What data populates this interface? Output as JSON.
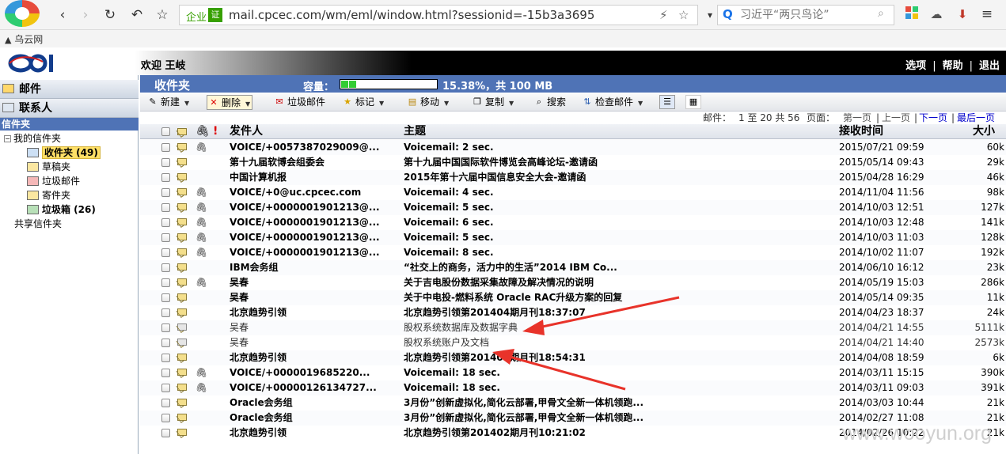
{
  "browser": {
    "url_badge": "企业",
    "cert_badge": "证",
    "url": "mail.cpcec.com/wm/eml/window.html?sessionid=-15b3a3695",
    "search_placeholder": "习近平“两只鸟论”",
    "bookmark": "乌云网"
  },
  "header": {
    "welcome": "欢迎 王岐",
    "links": [
      "选项",
      "帮助",
      "退出"
    ]
  },
  "sidebar": {
    "tabs": [
      "邮件",
      "联系人"
    ],
    "folder_header": "信件夹",
    "my_folders": "我的信件夹",
    "folders": [
      {
        "label": "收件夹 (49)",
        "icon": "inbox-icon",
        "selected": true
      },
      {
        "label": "草稿夹",
        "icon": "draft-folder-icon"
      },
      {
        "label": "垃圾邮件",
        "icon": "spam-folder-icon"
      },
      {
        "label": "寄件夹",
        "icon": "sent-folder-icon"
      },
      {
        "label": "垃圾箱 (26)",
        "icon": "trash-folder-icon",
        "bold": true
      }
    ],
    "shared": "共享信件夹"
  },
  "main": {
    "folder_title": "收件夹",
    "capacity_label": "容量：",
    "capacity_percent": 15.38,
    "capacity_text": "15.38%，共 100 MB",
    "toolbar": {
      "new": "新建",
      "delete": "删除",
      "spam": "垃圾邮件",
      "mark": "标记",
      "move": "移动",
      "copy": "复制",
      "search": "搜索",
      "check": "检查邮件"
    },
    "pager": {
      "mail_label": "邮件：",
      "range": "1 至 20 共 56",
      "page_label": "页面：",
      "first": "第一页",
      "sep": "|",
      "prev": "上一页",
      "next": "下一页",
      "last": "最后一页"
    },
    "columns": {
      "sender": "发件人",
      "subject": "主题",
      "date": "接收时间",
      "size": "大小"
    },
    "messages": [
      {
        "sender": "VOICE/+0057387029009@...",
        "subject": "Voicemail: 2 sec.",
        "date": "2015/07/21 09:59",
        "size": "60k"
      },
      {
        "sender": "第十九届软博会组委会",
        "subject": "第十九届中国国际软件博览会高峰论坛-邀请函",
        "date": "2015/05/14 09:43",
        "size": "29k"
      },
      {
        "sender": "中国计算机报",
        "subject": "2015年第十六届中国信息安全大会-邀请函",
        "date": "2015/04/28 16:29",
        "size": "46k"
      },
      {
        "sender": "VOICE/+0@uc.cpcec.com",
        "subject": "Voicemail: 4 sec.",
        "date": "2014/11/04 11:56",
        "size": "98k"
      },
      {
        "sender": "VOICE/+000000190121З@...",
        "subject": "Voicemail: 5 sec.",
        "date": "2014/10/03 12:51",
        "size": "127k"
      },
      {
        "sender": "VOICE/+000000190121З@...",
        "subject": "Voicemail: 6 sec.",
        "date": "2014/10/03 12:48",
        "size": "141k"
      },
      {
        "sender": "VOICE/+000000190121З@...",
        "subject": "Voicemail: 5 sec.",
        "date": "2014/10/03 11:03",
        "size": "128k"
      },
      {
        "sender": "VOICE/+000000190121З@...",
        "subject": "Voicemail: 8 sec.",
        "date": "2014/10/02 11:07",
        "size": "192k"
      },
      {
        "sender": "IBM会务组",
        "subject": "“社交上的商务，活力中的生活”2014 IBM Co...",
        "date": "2014/06/10 16:12",
        "size": "23k"
      },
      {
        "sender": "吴春",
        "subject": "关于吉电股份数据采集故障及解决情况的说明",
        "date": "2014/05/19 15:03",
        "size": "286k"
      },
      {
        "sender": "吴春",
        "subject": "关于中电投-燃料系统 Oracle RAC升级方案的回复",
        "date": "2014/05/14 09:35",
        "size": "11k"
      },
      {
        "sender": "北京趋势引领",
        "subject": "北京趋势引领第201404期月刊18:37:07",
        "date": "2014/04/23 18:37",
        "size": "24k"
      },
      {
        "sender": "吴春",
        "subject": "股权系统数据库及数据字典",
        "date": "2014/04/21 14:55",
        "size": "5111k"
      },
      {
        "sender": "吴春",
        "subject": "股权系统账户及文档",
        "date": "2014/04/21 14:40",
        "size": "2573k"
      },
      {
        "sender": "北京趋势引领",
        "subject": "北京趋势引领第201403期月刊18:54:31",
        "date": "2014/04/08 18:59",
        "size": "6k"
      },
      {
        "sender": "VOICE/+0000019685220...",
        "subject": "Voicemail: 18 sec.",
        "date": "2014/03/11 15:15",
        "size": "390k"
      },
      {
        "sender": "VOICE/+00000126134727...",
        "subject": "Voicemail: 18 sec.",
        "date": "2014/03/11 09:03",
        "size": "391k"
      },
      {
        "sender": "Oracle会务组",
        "subject": "3月份”创新虚拟化,简化云部署,甲骨文全新一体机领跑...",
        "date": "2014/03/03 10:44",
        "size": "21k"
      },
      {
        "sender": "Oracle会务组",
        "subject": "3月份”创新虚拟化,简化云部署,甲骨文全新一体机领跑...",
        "date": "2014/02/27 11:08",
        "size": "21k"
      },
      {
        "sender": "北京趋势引领",
        "subject": "北京趋势引领第201402期月刊10:21:02",
        "date": "2014/02/26 10:22",
        "size": "21k"
      }
    ],
    "watermark": "www.wooyun.org"
  }
}
